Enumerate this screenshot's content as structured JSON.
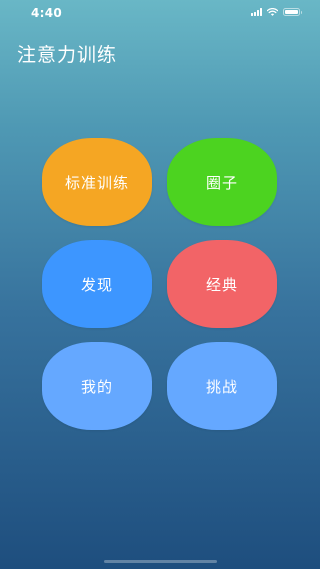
{
  "status_bar": {
    "time": "4:40",
    "icons": [
      "signal-icon",
      "wifi-icon",
      "battery-icon"
    ]
  },
  "header": {
    "title": "注意力训练"
  },
  "menu": {
    "tiles": [
      {
        "label": "标准训练",
        "color": "#f5a623"
      },
      {
        "label": "圈子",
        "color": "#4cd320"
      },
      {
        "label": "发现",
        "color": "#3d96ff"
      },
      {
        "label": "经典",
        "color": "#f26467"
      },
      {
        "label": "我的",
        "color": "#65a8ff"
      },
      {
        "label": "挑战",
        "color": "#65a8ff"
      }
    ]
  },
  "colors": {
    "background_top": "#69b7c6",
    "background_bottom": "#1e4e7e",
    "text": "#ffffff"
  }
}
